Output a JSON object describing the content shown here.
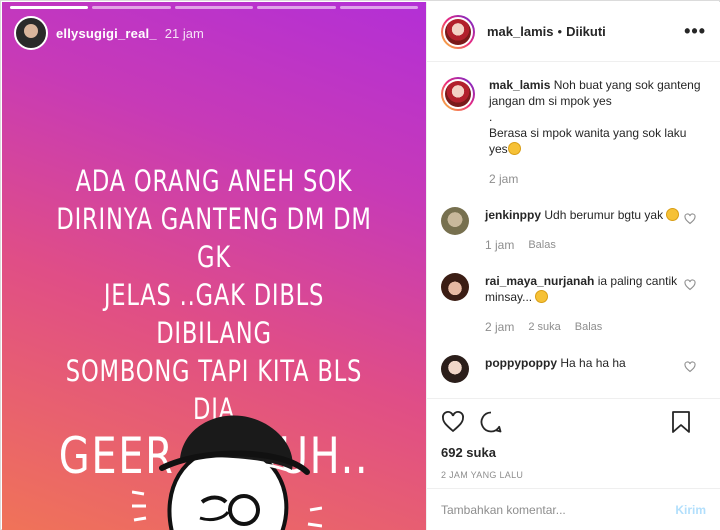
{
  "story": {
    "username": "ellysugigi_real_",
    "time": "21 jam",
    "text_lines": [
      "ADA ORANG ANEH SOK",
      "DIRINYA GANTENG DM DM GK",
      "JELAS ..GAK DIBLS DIBILANG",
      "SOMBONG TAPI KITA BLS DIA"
    ],
    "text_big": "GEER ..ADUH.."
  },
  "header": {
    "username": "mak_lamis",
    "separator": "•",
    "follow_status": "Diikuti",
    "more": "•••"
  },
  "caption": {
    "username": "mak_lamis",
    "line1": "Noh buat yang sok ganteng jangan dm si mpok yes",
    "line2": ".",
    "line3": "Berasa si mpok wanita yang sok laku yes",
    "time": "2 jam"
  },
  "comments": [
    {
      "username": "jenkinppy",
      "text": "Udh berumur bgtu yak",
      "emoji": true,
      "time": "1 jam",
      "likes": "",
      "reply": "Balas"
    },
    {
      "username": "rai_maya_nurjanah",
      "text": "ia paling cantik minsay...",
      "emoji": true,
      "time": "2 jam",
      "likes": "2 suka",
      "reply": "Balas"
    },
    {
      "username": "poppypoppy",
      "text": "Ha ha ha ha",
      "emoji": false,
      "time": "",
      "likes": "",
      "reply": ""
    }
  ],
  "actions": {
    "likes": "692 suka",
    "posted": "2 JAM YANG LALU"
  },
  "add_comment": {
    "placeholder": "Tambahkan komentar...",
    "post": "Kirim"
  }
}
